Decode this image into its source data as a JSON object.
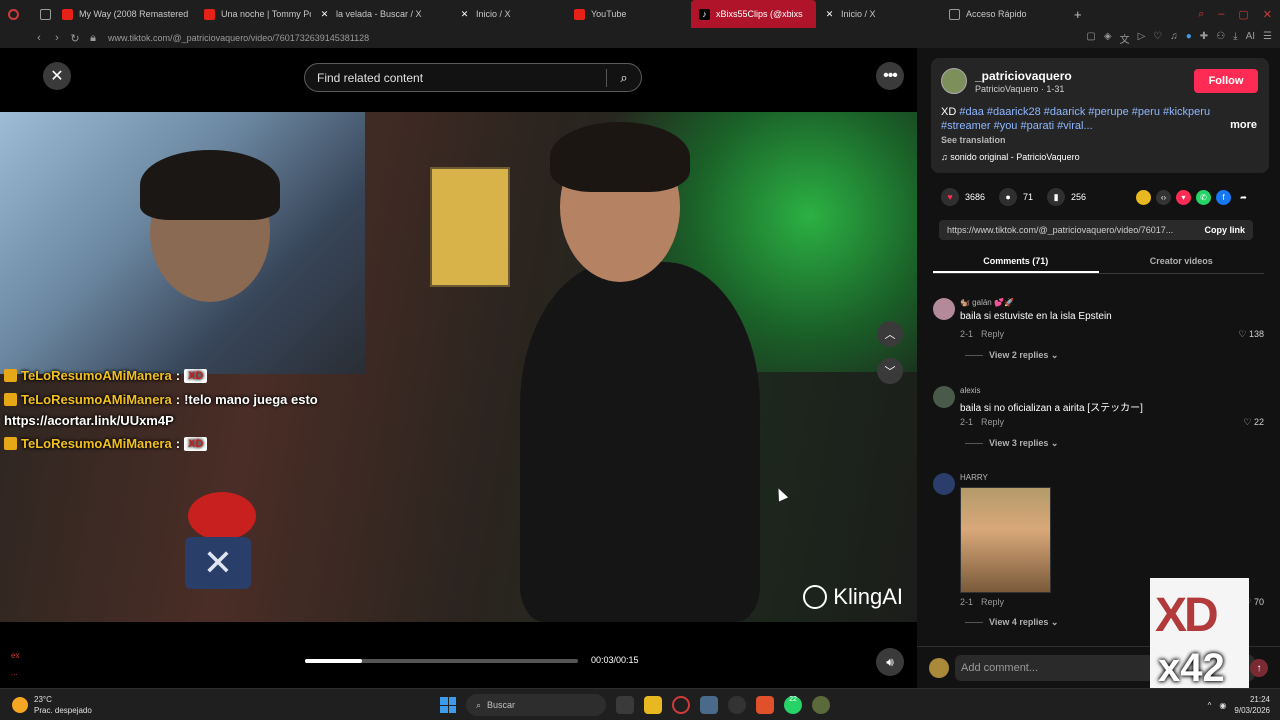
{
  "browser": {
    "tabs": [
      {
        "label": "My Way (2008 Remastered",
        "color": "#e62117"
      },
      {
        "label": "Una noche | Tommy Portu",
        "color": "#e62117"
      },
      {
        "label": "la velada - Buscar / X",
        "color": "#333333"
      },
      {
        "label": "Inicio / X",
        "color": "#333333"
      },
      {
        "label": "YouTube",
        "color": "#e62117"
      },
      {
        "label": "xBixs55Clips (@xbixs",
        "color": "#000000",
        "active": true
      },
      {
        "label": "Inicio / X",
        "color": "#333333"
      },
      {
        "label": "Acceso Rápido",
        "color": "#555555"
      }
    ],
    "url": "www.tiktok.com/@_patriciovaquero/video/7601732639145381128",
    "ext_label": "AI"
  },
  "video": {
    "search_placeholder": "Find related content",
    "chat": [
      {
        "user": "TeLoResumoAMiManera",
        "sep": ":",
        "message": "",
        "emote": "XD"
      },
      {
        "user": "TeLoResumoAMiManera",
        "sep": ":",
        "message": "!telo mano juega esto",
        "emote": ""
      },
      {
        "user": "",
        "sep": "",
        "message": "https://acortar.link/UUxm4P",
        "emote": ""
      },
      {
        "user": "TeLoResumoAMiManera",
        "sep": ":",
        "message": "",
        "emote": "XD"
      }
    ],
    "watermark": "KlingAI",
    "time": "00:03/00:15",
    "progress": 0.21,
    "side_letters": [
      "ex",
      "..."
    ]
  },
  "post": {
    "username": "_patriciovaquero",
    "subname": "PatricioVaquero · 1-31",
    "follow_label": "Follow",
    "desc_prefix": "XD ",
    "desc_tags": "#daa #daarick28 #daarick #perupe #peru #kickperu #streamer #you #parati #viral...",
    "more_label": "more",
    "see_translation": "See translation",
    "sound": "♫  sonido original - PatricioVaquero",
    "likes": "3686",
    "comments_count": "71",
    "saves": "256",
    "link": "https://www.tiktok.com/@_patriciovaquero/video/76017...",
    "copy_label": "Copy link",
    "tab_comments": "Comments (71)",
    "tab_creator": "Creator videos",
    "add_placeholder": "Add comment..."
  },
  "comments": [
    {
      "user": "🐿️ galán 💕🚀",
      "text": "baila si estuviste en la isla Epstein",
      "date": "2-1",
      "reply": "Reply",
      "likes": "138",
      "view": "View 2 replies ⌄"
    },
    {
      "user": "alexis",
      "text": "baila si no oficializan a airita [ステッカー]",
      "date": "2-1",
      "reply": "Reply",
      "likes": "22",
      "view": "View 3 replies ⌄"
    },
    {
      "user": "HARRY",
      "text": "",
      "date": "2-1",
      "reply": "Reply",
      "likes": "70",
      "view": "View 4 replies ⌄"
    }
  ],
  "overlay": {
    "xd": "XD",
    "count": "x42"
  },
  "taskbar": {
    "temp": "23°C",
    "weather": "Prac. despejado",
    "search": "Buscar",
    "time": "21:24",
    "date": "9/03/2026",
    "badge": "22"
  }
}
